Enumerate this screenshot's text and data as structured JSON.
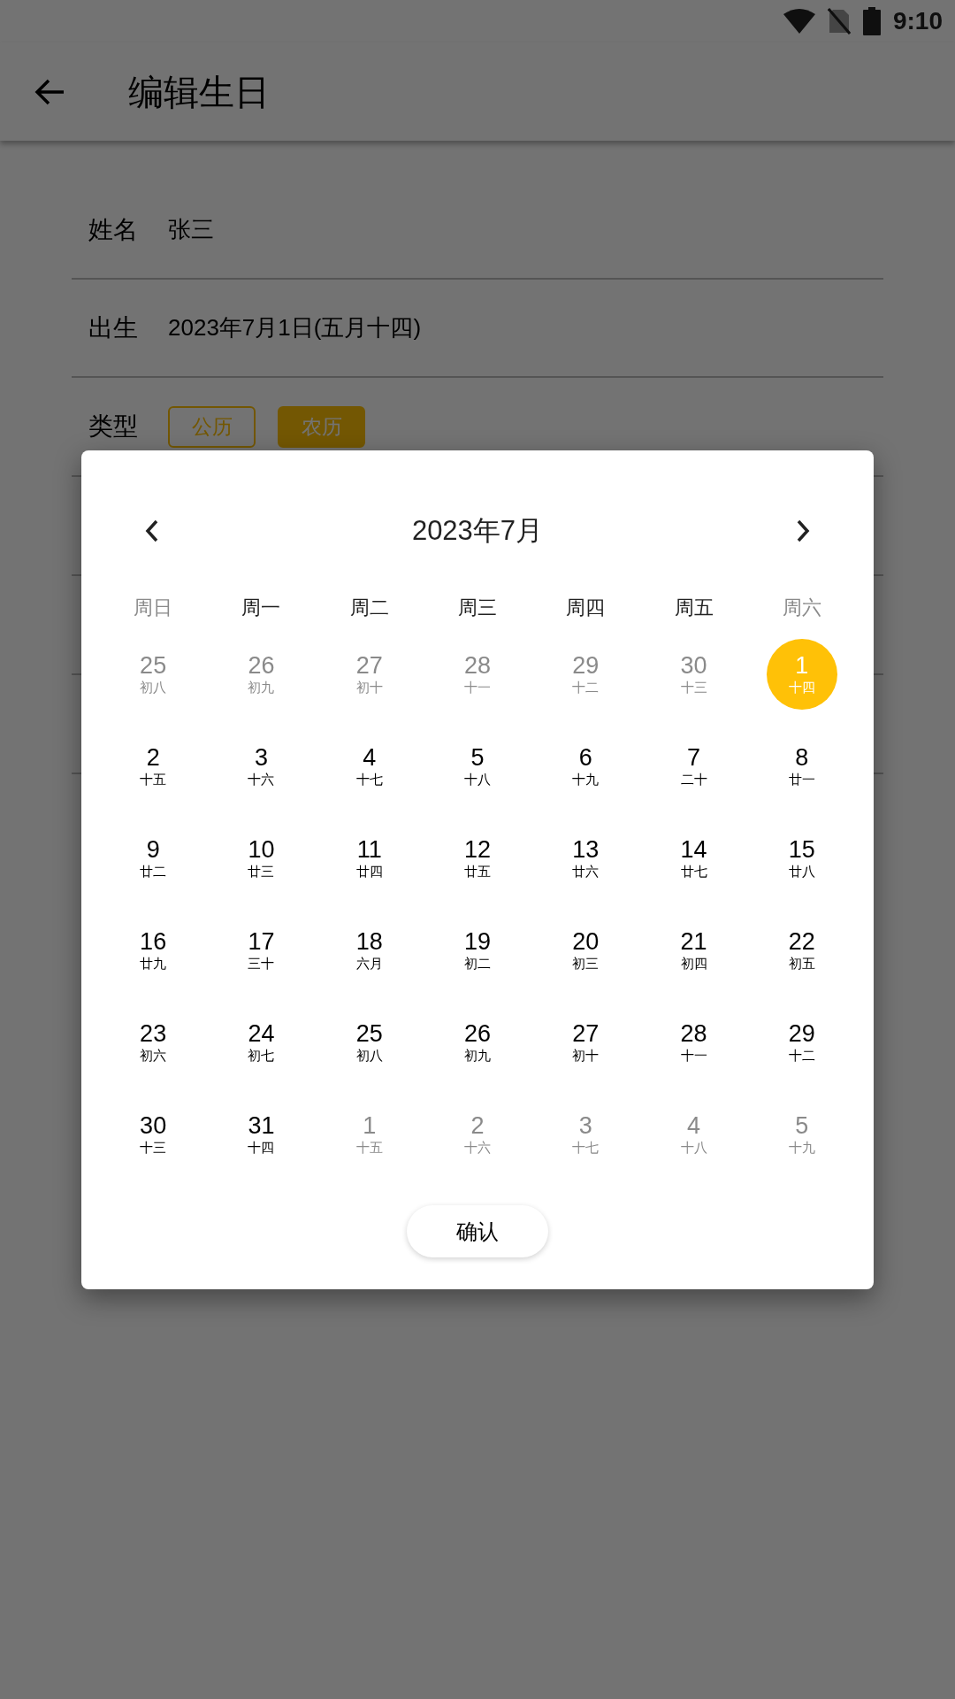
{
  "status_bar": {
    "time": "9:10"
  },
  "app_bar": {
    "title": "编辑生日"
  },
  "form": {
    "rows": [
      {
        "label": "姓名",
        "value": "张三"
      },
      {
        "label": "出生",
        "value": "2023年7月1日(五月十四)"
      }
    ],
    "type_row": {
      "label": "类型",
      "options": [
        {
          "label": "公历",
          "selected": false
        },
        {
          "label": "农历",
          "selected": true
        }
      ]
    }
  },
  "dialog": {
    "month": "2023年7月",
    "weekdays": [
      {
        "label": "周日",
        "weekend": true
      },
      {
        "label": "周一",
        "weekend": false
      },
      {
        "label": "周二",
        "weekend": false
      },
      {
        "label": "周三",
        "weekend": false
      },
      {
        "label": "周四",
        "weekend": false
      },
      {
        "label": "周五",
        "weekend": false
      },
      {
        "label": "周六",
        "weekend": true
      }
    ],
    "weeks": [
      [
        {
          "day": "25",
          "lunar": "初八",
          "outside": true,
          "selected": false
        },
        {
          "day": "26",
          "lunar": "初九",
          "outside": true,
          "selected": false
        },
        {
          "day": "27",
          "lunar": "初十",
          "outside": true,
          "selected": false
        },
        {
          "day": "28",
          "lunar": "十一",
          "outside": true,
          "selected": false
        },
        {
          "day": "29",
          "lunar": "十二",
          "outside": true,
          "selected": false
        },
        {
          "day": "30",
          "lunar": "十三",
          "outside": true,
          "selected": false
        },
        {
          "day": "1",
          "lunar": "十四",
          "outside": false,
          "selected": true
        }
      ],
      [
        {
          "day": "2",
          "lunar": "十五",
          "outside": false,
          "selected": false
        },
        {
          "day": "3",
          "lunar": "十六",
          "outside": false,
          "selected": false
        },
        {
          "day": "4",
          "lunar": "十七",
          "outside": false,
          "selected": false
        },
        {
          "day": "5",
          "lunar": "十八",
          "outside": false,
          "selected": false
        },
        {
          "day": "6",
          "lunar": "十九",
          "outside": false,
          "selected": false
        },
        {
          "day": "7",
          "lunar": "二十",
          "outside": false,
          "selected": false
        },
        {
          "day": "8",
          "lunar": "廿一",
          "outside": false,
          "selected": false
        }
      ],
      [
        {
          "day": "9",
          "lunar": "廿二",
          "outside": false,
          "selected": false
        },
        {
          "day": "10",
          "lunar": "廿三",
          "outside": false,
          "selected": false
        },
        {
          "day": "11",
          "lunar": "廿四",
          "outside": false,
          "selected": false
        },
        {
          "day": "12",
          "lunar": "廿五",
          "outside": false,
          "selected": false
        },
        {
          "day": "13",
          "lunar": "廿六",
          "outside": false,
          "selected": false
        },
        {
          "day": "14",
          "lunar": "廿七",
          "outside": false,
          "selected": false
        },
        {
          "day": "15",
          "lunar": "廿八",
          "outside": false,
          "selected": false
        }
      ],
      [
        {
          "day": "16",
          "lunar": "廿九",
          "outside": false,
          "selected": false
        },
        {
          "day": "17",
          "lunar": "三十",
          "outside": false,
          "selected": false
        },
        {
          "day": "18",
          "lunar": "六月",
          "outside": false,
          "selected": false
        },
        {
          "day": "19",
          "lunar": "初二",
          "outside": false,
          "selected": false
        },
        {
          "day": "20",
          "lunar": "初三",
          "outside": false,
          "selected": false
        },
        {
          "day": "21",
          "lunar": "初四",
          "outside": false,
          "selected": false
        },
        {
          "day": "22",
          "lunar": "初五",
          "outside": false,
          "selected": false
        }
      ],
      [
        {
          "day": "23",
          "lunar": "初六",
          "outside": false,
          "selected": false
        },
        {
          "day": "24",
          "lunar": "初七",
          "outside": false,
          "selected": false
        },
        {
          "day": "25",
          "lunar": "初八",
          "outside": false,
          "selected": false
        },
        {
          "day": "26",
          "lunar": "初九",
          "outside": false,
          "selected": false
        },
        {
          "day": "27",
          "lunar": "初十",
          "outside": false,
          "selected": false
        },
        {
          "day": "28",
          "lunar": "十一",
          "outside": false,
          "selected": false
        },
        {
          "day": "29",
          "lunar": "十二",
          "outside": false,
          "selected": false
        }
      ],
      [
        {
          "day": "30",
          "lunar": "十三",
          "outside": false,
          "selected": false
        },
        {
          "day": "31",
          "lunar": "十四",
          "outside": false,
          "selected": false
        },
        {
          "day": "1",
          "lunar": "十五",
          "outside": true,
          "selected": false
        },
        {
          "day": "2",
          "lunar": "十六",
          "outside": true,
          "selected": false
        },
        {
          "day": "3",
          "lunar": "十七",
          "outside": true,
          "selected": false
        },
        {
          "day": "4",
          "lunar": "十八",
          "outside": true,
          "selected": false
        },
        {
          "day": "5",
          "lunar": "十九",
          "outside": true,
          "selected": false
        }
      ]
    ],
    "confirm": "确认"
  }
}
